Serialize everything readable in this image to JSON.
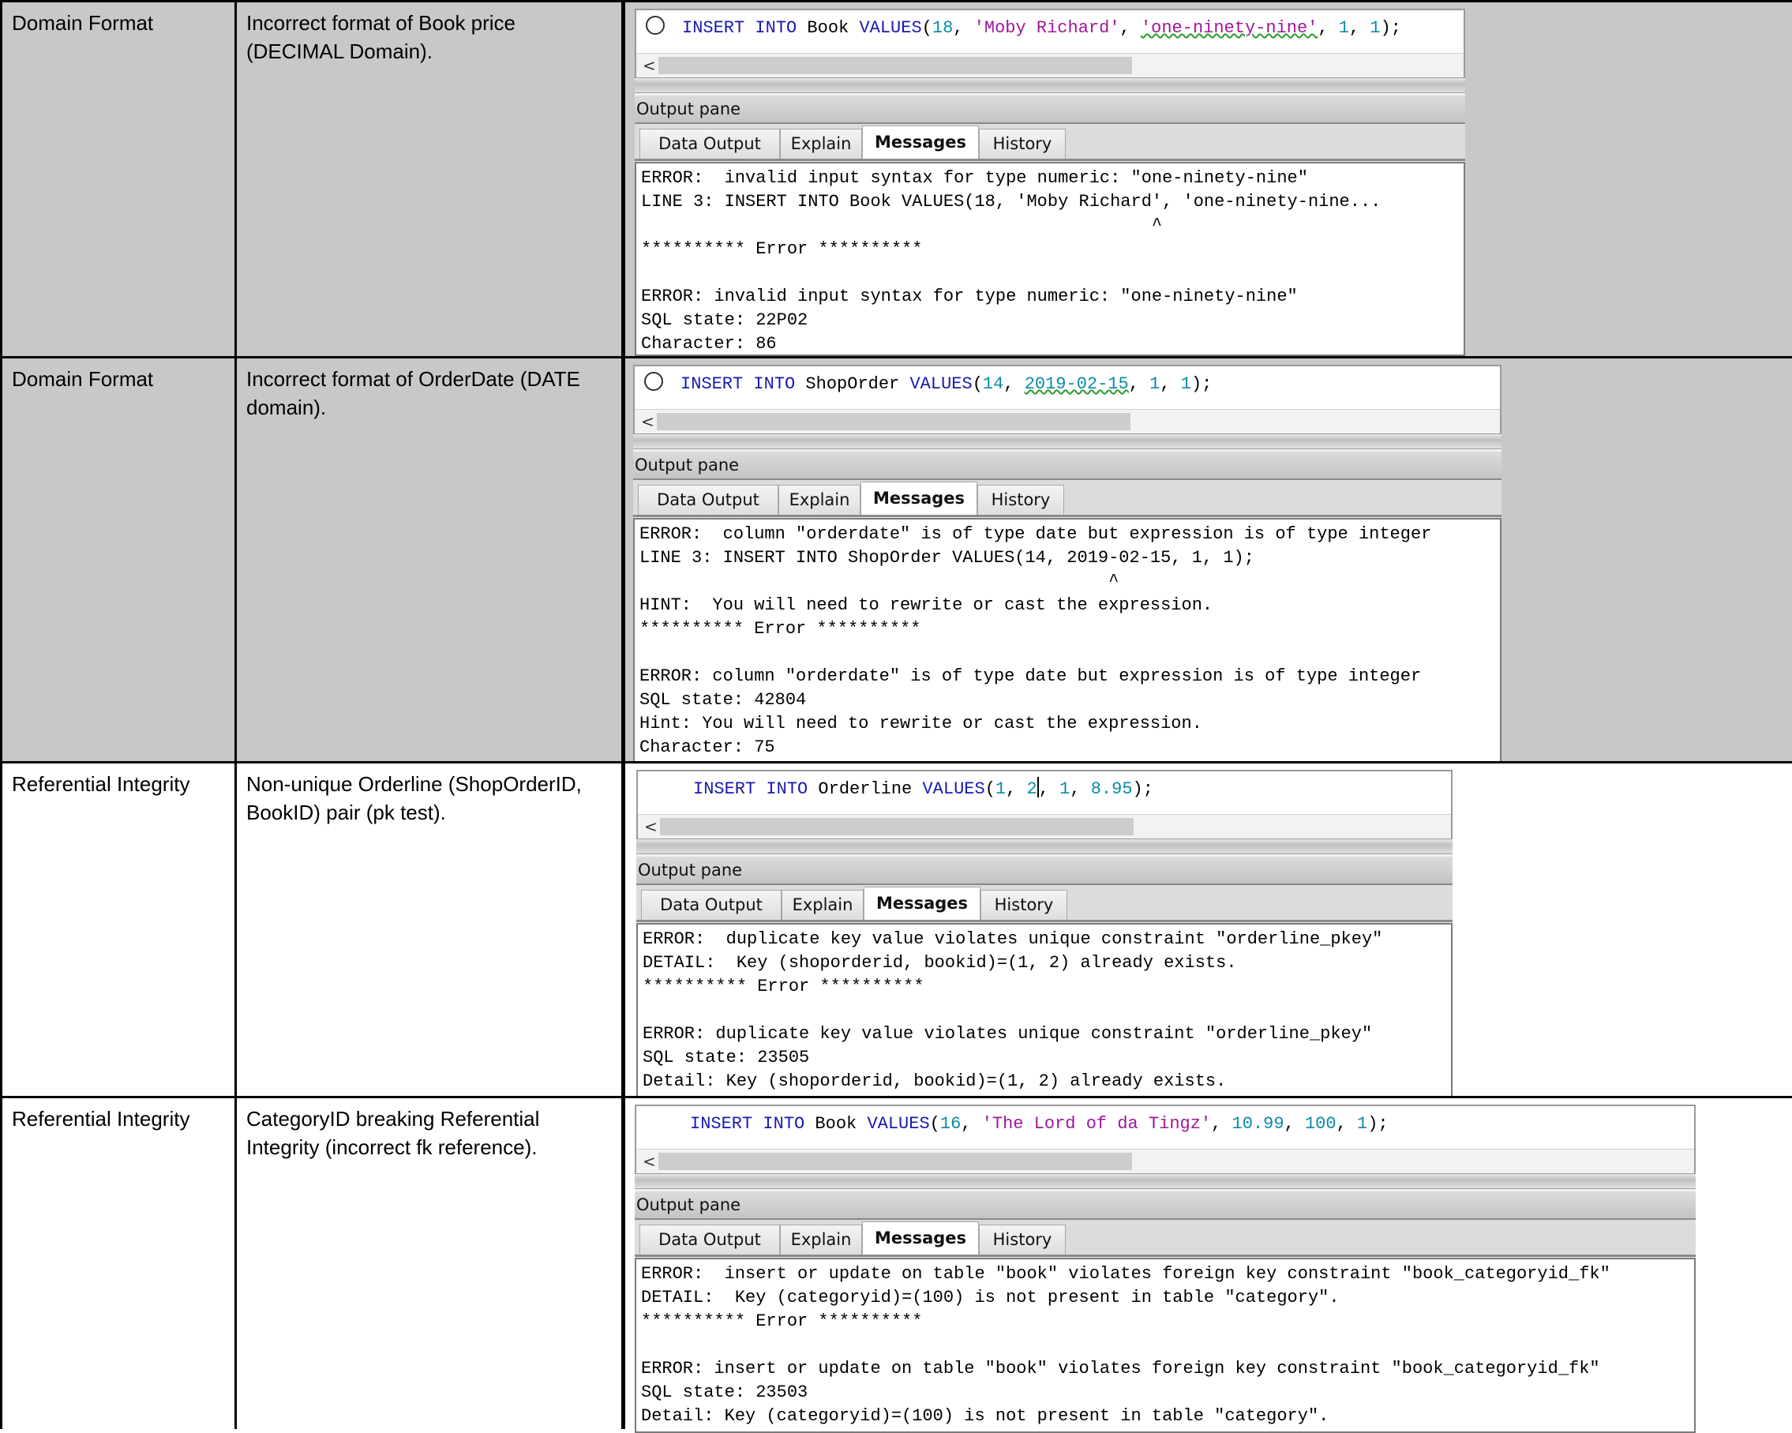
{
  "rows": [
    {
      "type": "Domain Format",
      "description": "Incorrect format of Book price (DECIMAL Domain).",
      "query": {
        "kw1": "INSERT INTO",
        "table": " Book ",
        "kw2": "VALUES",
        "p1": "(",
        "n1": "18",
        "c1": ", ",
        "s1": "'Moby Richard'",
        "c2": ", ",
        "bad": "'one-ninety-nine'",
        "c3": ", ",
        "n2": "1",
        "c4": ", ",
        "n3": "1",
        "end": ");"
      },
      "pane_title": "Output pane",
      "tabs": [
        "Data Output",
        "Explain",
        "Messages",
        "History"
      ],
      "messages": "ERROR:  invalid input syntax for type numeric: \"one-ninety-nine\"\nLINE 3: INSERT INTO Book VALUES(18, 'Moby Richard', 'one-ninety-nine...\n                                                 ^\n********** Error **********\n\nERROR: invalid input syntax for type numeric: \"one-ninety-nine\"\nSQL state: 22P02\nCharacter: 86"
    },
    {
      "type": "Domain Format",
      "description": "Incorrect format of OrderDate (DATE domain).",
      "query": {
        "kw1": "INSERT INTO",
        "table": " ShopOrder ",
        "kw2": "VALUES",
        "p1": "(",
        "n1": "14",
        "c1": ", ",
        "bad": "2019-02-15",
        "c2": ", ",
        "n2": "1",
        "c3": ", ",
        "n3": "1",
        "end": ");"
      },
      "pane_title": "Output pane",
      "tabs": [
        "Data Output",
        "Explain",
        "Messages",
        "History"
      ],
      "messages": "ERROR:  column \"orderdate\" is of type date but expression is of type integer\nLINE 3: INSERT INTO ShopOrder VALUES(14, 2019-02-15, 1, 1);\n                                             ^\nHINT:  You will need to rewrite or cast the expression.\n********** Error **********\n\nERROR: column \"orderdate\" is of type date but expression is of type integer\nSQL state: 42804\nHint: You will need to rewrite or cast the expression.\nCharacter: 75"
    },
    {
      "type": "Referential Integrity",
      "description": "Non-unique Orderline (ShopOrderID, BookID) pair (pk test).",
      "query": {
        "kw1": "INSERT INTO",
        "table": " Orderline ",
        "kw2": "VALUES",
        "p1": "(",
        "n1": "1",
        "c1": ", ",
        "n2": "2",
        "c2": ", ",
        "n3": "1",
        "c3": ", ",
        "n4": "8.95",
        "end": ");"
      },
      "pane_title": "Output pane",
      "tabs": [
        "Data Output",
        "Explain",
        "Messages",
        "History"
      ],
      "messages": "ERROR:  duplicate key value violates unique constraint \"orderline_pkey\"\nDETAIL:  Key (shoporderid, bookid)=(1, 2) already exists.\n********** Error **********\n\nERROR: duplicate key value violates unique constraint \"orderline_pkey\"\nSQL state: 23505\nDetail: Key (shoporderid, bookid)=(1, 2) already exists."
    },
    {
      "type": "Referential Integrity",
      "description": "CategoryID breaking Referential Integrity (incorrect fk reference).",
      "query": {
        "kw1": "INSERT INTO",
        "table": " Book ",
        "kw2": "VALUES",
        "p1": "(",
        "n1": "16",
        "c1": ", ",
        "s1": "'The Lord of da Tingz'",
        "c2": ", ",
        "n2": "10.99",
        "c3": ", ",
        "n3": "100",
        "c4": ", ",
        "n4": "1",
        "end": ");"
      },
      "pane_title": "Output pane",
      "tabs": [
        "Data Output",
        "Explain",
        "Messages",
        "History"
      ],
      "messages": "ERROR:  insert or update on table \"book\" violates foreign key constraint \"book_categoryid_fk\"\nDETAIL:  Key (categoryid)=(100) is not present in table \"category\".\n********** Error **********\n\nERROR: insert or update on table \"book\" violates foreign key constraint \"book_categoryid_fk\"\nSQL state: 23503\nDetail: Key (categoryid)=(100) is not present in table \"category\"."
    }
  ]
}
